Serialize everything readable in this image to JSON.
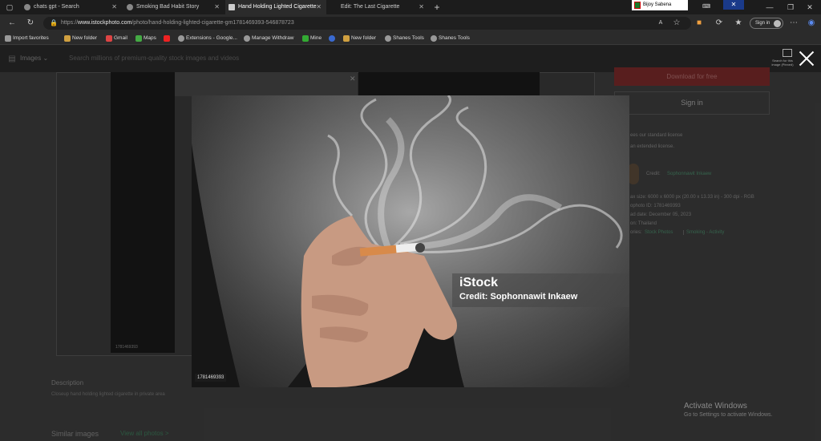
{
  "browser": {
    "tabs": [
      {
        "label": "chats gpt - Search"
      },
      {
        "label": "Smoking Bad Habit Story"
      },
      {
        "label": "Hand Holding Lighted Cigarette"
      },
      {
        "label": "Edit: The Last Cigarette"
      }
    ],
    "ime_label": "Bijoy Sabena",
    "url_prefix": "https://",
    "url_domain": "www.istockphoto.com",
    "url_path": "/photo/hand-holding-lighted-cigarette-gm1781469393-546878723",
    "sign_in": "Sign in",
    "bookmarks": [
      "Import favorites",
      "New folder",
      "Gmail",
      "Maps",
      "Extensions - Google...",
      "Manage Withdraw",
      "Mine",
      "New folder",
      "Shanes Tools",
      "Shanes Tools"
    ]
  },
  "site": {
    "images_dropdown": "Images",
    "search_placeholder": "Search millions of premium-quality stock images and videos",
    "download_button": "Download for free",
    "signin_button": "Sign in",
    "license_line1": "ees our standard license",
    "license_line2": "an extended license.",
    "credit_label": "Credit:",
    "credit_name": "Sophonnawit Inkaew",
    "max_size": "ax size: 6000 x 6000 px (20.00 x 13.33 in) - 300 dpi - RGB",
    "photo_id_line": "ophoto ID: 1781469393",
    "upload_date": "ad date: December 05, 2023",
    "location": "on: Thailand",
    "categories_prefix": "ories:",
    "category1": "Stock Photos",
    "category2": "Smoking - Activity",
    "bg_photo_id": "1781469393",
    "description_heading": "Description",
    "description_text": "Closeup hand holding lighted cigarette in private area",
    "similar_heading": "Similar images",
    "view_all": "View all photos >",
    "full_view_label": "Search for this image (Pinned)"
  },
  "modal": {
    "watermark_logo": "iStock",
    "watermark_credit": "Credit: Sophonnawit Inkaew",
    "photo_id": "1781469393"
  },
  "windows": {
    "activate_title": "Activate Windows",
    "activate_sub": "Go to Settings to activate Windows."
  }
}
